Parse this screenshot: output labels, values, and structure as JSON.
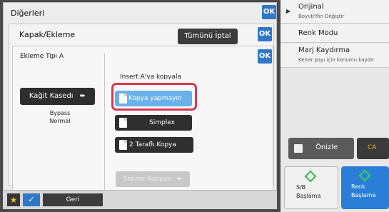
{
  "right_panel": {
    "items": [
      {
        "title": "Orijinal",
        "sub": "Boyut/Yön Değiştir"
      },
      {
        "title": "Renk Modu",
        "sub": ""
      },
      {
        "title": "Marj Kaydırma",
        "sub": "Kenar payı için konumu kaydır"
      }
    ],
    "preview_label": "Önizle",
    "ca_label": "CA",
    "bw_start": {
      "line1": "S/B",
      "line2": "Başlama"
    },
    "color_start": {
      "line1": "Renk",
      "line2": "Başlama"
    }
  },
  "dialogs": {
    "level1_title": "Diğerleri",
    "level2_title": "Kapak/Ekleme",
    "cancel_all": "Tümünü İptal",
    "level3_title": "Ekleme Tipı A",
    "ok_label": "OK"
  },
  "insert_panel": {
    "paper_tray_label": "Kağit Kasedı",
    "tray_info": {
      "line1": "Bypass",
      "line2": "Normal"
    },
    "group_label": "Insert A'ya kopyala",
    "options": [
      {
        "label": "Kopya yapmayın",
        "selected": true
      },
      {
        "label": "Simplex",
        "selected": false
      },
      {
        "label": "2 Taraflı.Kopya",
        "selected": false
      }
    ],
    "tab_copy_label": "Sekme Kopyası"
  },
  "bottom_bar": {
    "star_label": "★",
    "check_label": "✓",
    "back_label": "Geri"
  },
  "colors": {
    "accent": "#2f78c8",
    "selected_option": "#6ab0ea",
    "highlight": "#d63a4e",
    "color_start": "#2a7ed8",
    "dark_button": "#2f2f2f"
  }
}
